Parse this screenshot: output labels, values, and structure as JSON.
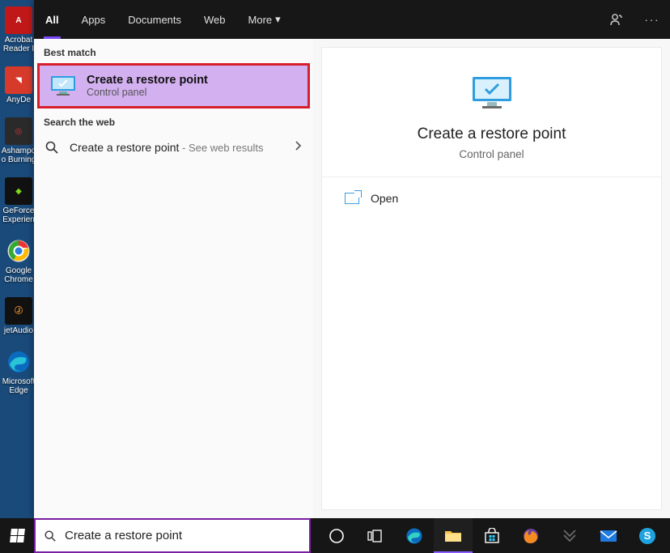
{
  "desktop": {
    "icons": [
      {
        "label": "Acrobat Reader I",
        "bg": "#c01818",
        "glyph": "A"
      },
      {
        "label": "AnyDe",
        "bg": "#d63a2a",
        "glyph": "▶"
      },
      {
        "label": "Ashampoo Burning",
        "bg": "#2a2a2a",
        "glyph": "◎"
      },
      {
        "label": "GeForce Experien",
        "bg": "#111",
        "glyph": "◆"
      },
      {
        "label": "Google Chrome",
        "bg": "transparent",
        "glyph": "●"
      },
      {
        "label": "jetAudio",
        "bg": "#111",
        "glyph": "♪"
      },
      {
        "label": "Microsoft Edge",
        "bg": "transparent",
        "glyph": "◐"
      }
    ]
  },
  "tabs": {
    "items": [
      "All",
      "Apps",
      "Documents",
      "Web",
      "More"
    ],
    "active_index": 0
  },
  "left_panel": {
    "best_match_label": "Best match",
    "best_result": {
      "title": "Create a restore point",
      "subtitle": "Control panel"
    },
    "search_web_label": "Search the web",
    "web_result": {
      "title": "Create a restore point",
      "hint": " - See web results"
    }
  },
  "right_panel": {
    "title": "Create a restore point",
    "subtitle": "Control panel",
    "actions": {
      "open": "Open"
    }
  },
  "taskbar": {
    "search_value": "Create a restore point",
    "icons": [
      "cortana",
      "taskview",
      "edge",
      "explorer",
      "store",
      "firefox",
      "predator",
      "mail",
      "skype"
    ]
  }
}
